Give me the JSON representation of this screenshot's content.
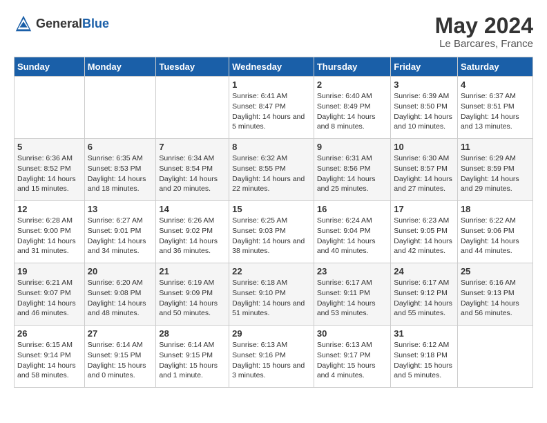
{
  "logo": {
    "text_general": "General",
    "text_blue": "Blue"
  },
  "title": "May 2024",
  "subtitle": "Le Barcares, France",
  "days_of_week": [
    "Sunday",
    "Monday",
    "Tuesday",
    "Wednesday",
    "Thursday",
    "Friday",
    "Saturday"
  ],
  "weeks": [
    [
      {
        "day": "",
        "info": ""
      },
      {
        "day": "",
        "info": ""
      },
      {
        "day": "",
        "info": ""
      },
      {
        "day": "1",
        "info": "Sunrise: 6:41 AM\nSunset: 8:47 PM\nDaylight: 14 hours\nand 5 minutes."
      },
      {
        "day": "2",
        "info": "Sunrise: 6:40 AM\nSunset: 8:49 PM\nDaylight: 14 hours\nand 8 minutes."
      },
      {
        "day": "3",
        "info": "Sunrise: 6:39 AM\nSunset: 8:50 PM\nDaylight: 14 hours\nand 10 minutes."
      },
      {
        "day": "4",
        "info": "Sunrise: 6:37 AM\nSunset: 8:51 PM\nDaylight: 14 hours\nand 13 minutes."
      }
    ],
    [
      {
        "day": "5",
        "info": "Sunrise: 6:36 AM\nSunset: 8:52 PM\nDaylight: 14 hours\nand 15 minutes."
      },
      {
        "day": "6",
        "info": "Sunrise: 6:35 AM\nSunset: 8:53 PM\nDaylight: 14 hours\nand 18 minutes."
      },
      {
        "day": "7",
        "info": "Sunrise: 6:34 AM\nSunset: 8:54 PM\nDaylight: 14 hours\nand 20 minutes."
      },
      {
        "day": "8",
        "info": "Sunrise: 6:32 AM\nSunset: 8:55 PM\nDaylight: 14 hours\nand 22 minutes."
      },
      {
        "day": "9",
        "info": "Sunrise: 6:31 AM\nSunset: 8:56 PM\nDaylight: 14 hours\nand 25 minutes."
      },
      {
        "day": "10",
        "info": "Sunrise: 6:30 AM\nSunset: 8:57 PM\nDaylight: 14 hours\nand 27 minutes."
      },
      {
        "day": "11",
        "info": "Sunrise: 6:29 AM\nSunset: 8:59 PM\nDaylight: 14 hours\nand 29 minutes."
      }
    ],
    [
      {
        "day": "12",
        "info": "Sunrise: 6:28 AM\nSunset: 9:00 PM\nDaylight: 14 hours\nand 31 minutes."
      },
      {
        "day": "13",
        "info": "Sunrise: 6:27 AM\nSunset: 9:01 PM\nDaylight: 14 hours\nand 34 minutes."
      },
      {
        "day": "14",
        "info": "Sunrise: 6:26 AM\nSunset: 9:02 PM\nDaylight: 14 hours\nand 36 minutes."
      },
      {
        "day": "15",
        "info": "Sunrise: 6:25 AM\nSunset: 9:03 PM\nDaylight: 14 hours\nand 38 minutes."
      },
      {
        "day": "16",
        "info": "Sunrise: 6:24 AM\nSunset: 9:04 PM\nDaylight: 14 hours\nand 40 minutes."
      },
      {
        "day": "17",
        "info": "Sunrise: 6:23 AM\nSunset: 9:05 PM\nDaylight: 14 hours\nand 42 minutes."
      },
      {
        "day": "18",
        "info": "Sunrise: 6:22 AM\nSunset: 9:06 PM\nDaylight: 14 hours\nand 44 minutes."
      }
    ],
    [
      {
        "day": "19",
        "info": "Sunrise: 6:21 AM\nSunset: 9:07 PM\nDaylight: 14 hours\nand 46 minutes."
      },
      {
        "day": "20",
        "info": "Sunrise: 6:20 AM\nSunset: 9:08 PM\nDaylight: 14 hours\nand 48 minutes."
      },
      {
        "day": "21",
        "info": "Sunrise: 6:19 AM\nSunset: 9:09 PM\nDaylight: 14 hours\nand 50 minutes."
      },
      {
        "day": "22",
        "info": "Sunrise: 6:18 AM\nSunset: 9:10 PM\nDaylight: 14 hours\nand 51 minutes."
      },
      {
        "day": "23",
        "info": "Sunrise: 6:17 AM\nSunset: 9:11 PM\nDaylight: 14 hours\nand 53 minutes."
      },
      {
        "day": "24",
        "info": "Sunrise: 6:17 AM\nSunset: 9:12 PM\nDaylight: 14 hours\nand 55 minutes."
      },
      {
        "day": "25",
        "info": "Sunrise: 6:16 AM\nSunset: 9:13 PM\nDaylight: 14 hours\nand 56 minutes."
      }
    ],
    [
      {
        "day": "26",
        "info": "Sunrise: 6:15 AM\nSunset: 9:14 PM\nDaylight: 14 hours\nand 58 minutes."
      },
      {
        "day": "27",
        "info": "Sunrise: 6:14 AM\nSunset: 9:15 PM\nDaylight: 15 hours\nand 0 minutes."
      },
      {
        "day": "28",
        "info": "Sunrise: 6:14 AM\nSunset: 9:15 PM\nDaylight: 15 hours\nand 1 minute."
      },
      {
        "day": "29",
        "info": "Sunrise: 6:13 AM\nSunset: 9:16 PM\nDaylight: 15 hours\nand 3 minutes."
      },
      {
        "day": "30",
        "info": "Sunrise: 6:13 AM\nSunset: 9:17 PM\nDaylight: 15 hours\nand 4 minutes."
      },
      {
        "day": "31",
        "info": "Sunrise: 6:12 AM\nSunset: 9:18 PM\nDaylight: 15 hours\nand 5 minutes."
      },
      {
        "day": "",
        "info": ""
      }
    ]
  ]
}
